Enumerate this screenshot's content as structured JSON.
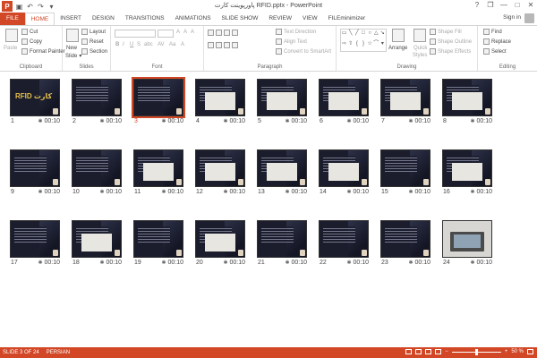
{
  "window": {
    "title": "پاورپوینت کارت RFID.pptx - PowerPoint",
    "app_logo": "P",
    "quick_access": [
      {
        "name": "save-icon",
        "glyph": "▣"
      },
      {
        "name": "undo-icon",
        "glyph": "↶"
      },
      {
        "name": "redo-icon",
        "glyph": "↷"
      },
      {
        "name": "qat-more-icon",
        "glyph": "▾"
      }
    ],
    "controls": {
      "help": "?",
      "restore": "❐",
      "minimize": "—",
      "maximize": "□",
      "close": "✕"
    }
  },
  "tabs": [
    "FILE",
    "HOME",
    "INSERT",
    "DESIGN",
    "TRANSITIONS",
    "ANIMATIONS",
    "SLIDE SHOW",
    "REVIEW",
    "VIEW",
    "FILEminimizer"
  ],
  "active_tab": "HOME",
  "signin": "Sign in",
  "ribbon": {
    "clipboard": {
      "paste": "Paste",
      "cut": "Cut",
      "copy": "Copy",
      "format_painter": "Format Painter",
      "label": "Clipboard"
    },
    "slides": {
      "new_slide": "New",
      "new_slide2": "Slide",
      "layout": "Layout",
      "reset": "Reset",
      "section": "Section",
      "label": "Slides"
    },
    "font": {
      "label": "Font",
      "b": "B",
      "i": "I",
      "u": "U",
      "s": "S",
      "abc": "abc",
      "av": "AV",
      "aa": "Aa",
      "grow": "A",
      "shrink": "A",
      "clear": "A",
      "font_color": "A"
    },
    "paragraph": {
      "text_direction": "Text Direction",
      "align_text": "Align Text",
      "convert": "Convert to SmartArt",
      "label": "Paragraph"
    },
    "drawing": {
      "arrange": "Arrange",
      "quick": "Quick",
      "styles": "Styles",
      "shape_fill": "Shape Fill",
      "shape_outline": "Shape Outline",
      "shape_effects": "Shape Effects",
      "label": "Drawing"
    },
    "editing": {
      "find": "Find",
      "replace": "Replace",
      "select": "Select",
      "label": "Editing"
    }
  },
  "slides": [
    {
      "num": "1",
      "time": "00:10",
      "kind": "title"
    },
    {
      "num": "2",
      "time": "00:10",
      "kind": "text"
    },
    {
      "num": "3",
      "time": "00:10",
      "kind": "text",
      "selected": true
    },
    {
      "num": "4",
      "time": "00:10",
      "kind": "image"
    },
    {
      "num": "5",
      "time": "00:10",
      "kind": "image"
    },
    {
      "num": "6",
      "time": "00:10",
      "kind": "image"
    },
    {
      "num": "7",
      "time": "00:10",
      "kind": "image"
    },
    {
      "num": "8",
      "time": "00:10",
      "kind": "image"
    },
    {
      "num": "9",
      "time": "00:10",
      "kind": "text"
    },
    {
      "num": "10",
      "time": "00:10",
      "kind": "text"
    },
    {
      "num": "11",
      "time": "00:10",
      "kind": "image"
    },
    {
      "num": "12",
      "time": "00:10",
      "kind": "image"
    },
    {
      "num": "13",
      "time": "00:10",
      "kind": "image"
    },
    {
      "num": "14",
      "time": "00:10",
      "kind": "image"
    },
    {
      "num": "15",
      "time": "00:10",
      "kind": "text"
    },
    {
      "num": "16",
      "time": "00:10",
      "kind": "image"
    },
    {
      "num": "17",
      "time": "00:10",
      "kind": "text"
    },
    {
      "num": "18",
      "time": "00:10",
      "kind": "image"
    },
    {
      "num": "19",
      "time": "00:10",
      "kind": "text"
    },
    {
      "num": "20",
      "time": "00:10",
      "kind": "image"
    },
    {
      "num": "21",
      "time": "00:10",
      "kind": "text"
    },
    {
      "num": "22",
      "time": "00:10",
      "kind": "text"
    },
    {
      "num": "23",
      "time": "00:10",
      "kind": "text"
    },
    {
      "num": "24",
      "time": "00:10",
      "kind": "photo"
    }
  ],
  "title_slide_text": "RFID کارت",
  "status": {
    "slide_of": "SLIDE 3 OF 24",
    "language": "PERSIAN",
    "zoom": "50 %",
    "zoom_minus": "−",
    "zoom_plus": "+"
  },
  "colors": {
    "accent": "#d24726",
    "slide_bg": "#1b1d2c"
  }
}
